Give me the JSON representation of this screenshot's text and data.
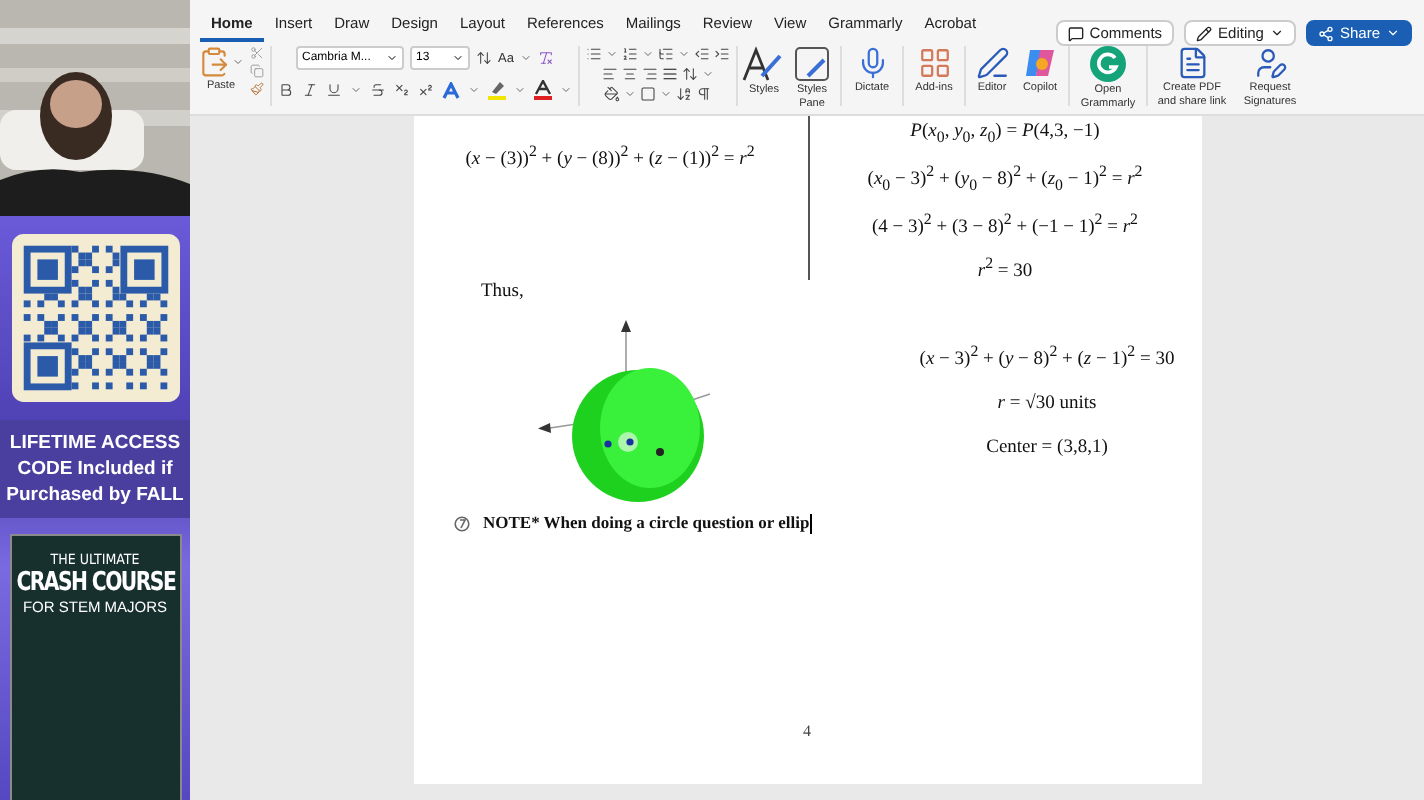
{
  "promo": {
    "headline": "LIFETIME ACCESS CODE Included if Purchased by FALL",
    "book": {
      "kicker": "THE ULTIMATE",
      "title": "CRASH COURSE",
      "subtitle": "FOR STEM MAJORS"
    }
  },
  "ribbon": {
    "tabs": [
      {
        "label": "Home",
        "selected": true
      },
      {
        "label": "Insert",
        "selected": false
      },
      {
        "label": "Draw",
        "selected": false
      },
      {
        "label": "Design",
        "selected": false
      },
      {
        "label": "Layout",
        "selected": false
      },
      {
        "label": "References",
        "selected": false
      },
      {
        "label": "Mailings",
        "selected": false
      },
      {
        "label": "Review",
        "selected": false
      },
      {
        "label": "View",
        "selected": false
      },
      {
        "label": "Grammarly",
        "selected": false
      },
      {
        "label": "Acrobat",
        "selected": false
      }
    ],
    "actions": [
      {
        "kind": "comments",
        "label": "Comments"
      },
      {
        "kind": "editing",
        "label": "Editing"
      },
      {
        "kind": "share",
        "label": "Share"
      }
    ],
    "paste_label": "Paste",
    "font_name": "Cambria M...",
    "font_size": "13",
    "case_label": "Aa",
    "large_buttons": [
      {
        "kind": "styles",
        "label": "Styles"
      },
      {
        "kind": "styles_pane",
        "label": "Styles Pane"
      },
      {
        "kind": "dictate",
        "label": "Dictate"
      },
      {
        "kind": "addins",
        "label": "Add-ins"
      },
      {
        "kind": "editor",
        "label": "Editor"
      },
      {
        "kind": "copilot",
        "label": "Copilot"
      },
      {
        "kind": "grammarly",
        "label": "Open Grammarly"
      },
      {
        "kind": "pdf",
        "label": "Create PDF and share link"
      },
      {
        "kind": "sign",
        "label": "Request Signatures"
      }
    ]
  },
  "document": {
    "left_equation": "(*x* − (3))$^{2}$ + (*y* − (8))$^{2}$ + (*z* − (1))$^{2}$ = *r*$^{2}$",
    "right_equations": [
      "*P*(*x*$_{0}$, *y*$_{0}$, *z*$_{0}$) = *P*(4,3, −1)",
      "(*x*$_{0}$ − 3)$^{2}$ + (*y*$_{0}$ − 8)$^{2}$ + (*z*$_{0}$ − 1)$^{2}$ = *r*$^{2}$",
      "(4 − 3)$^{2}$ + (3 − 8)$^{2}$ + (−1 − 1)$^{2}$ = *r*$^{2}$",
      "*r*$^{2}$ = 30"
    ],
    "thus": "Thus,",
    "results": [
      "(*x* − 3)$^{2}$ + (*y* − 8)$^{2}$ + (*z* − 1)$^{2}$ = 30",
      "*r* = √30 units",
      "Center = (3,8,1)"
    ],
    "note": "NOTE* When doing a circle question or ellip",
    "page_number": "4"
  }
}
